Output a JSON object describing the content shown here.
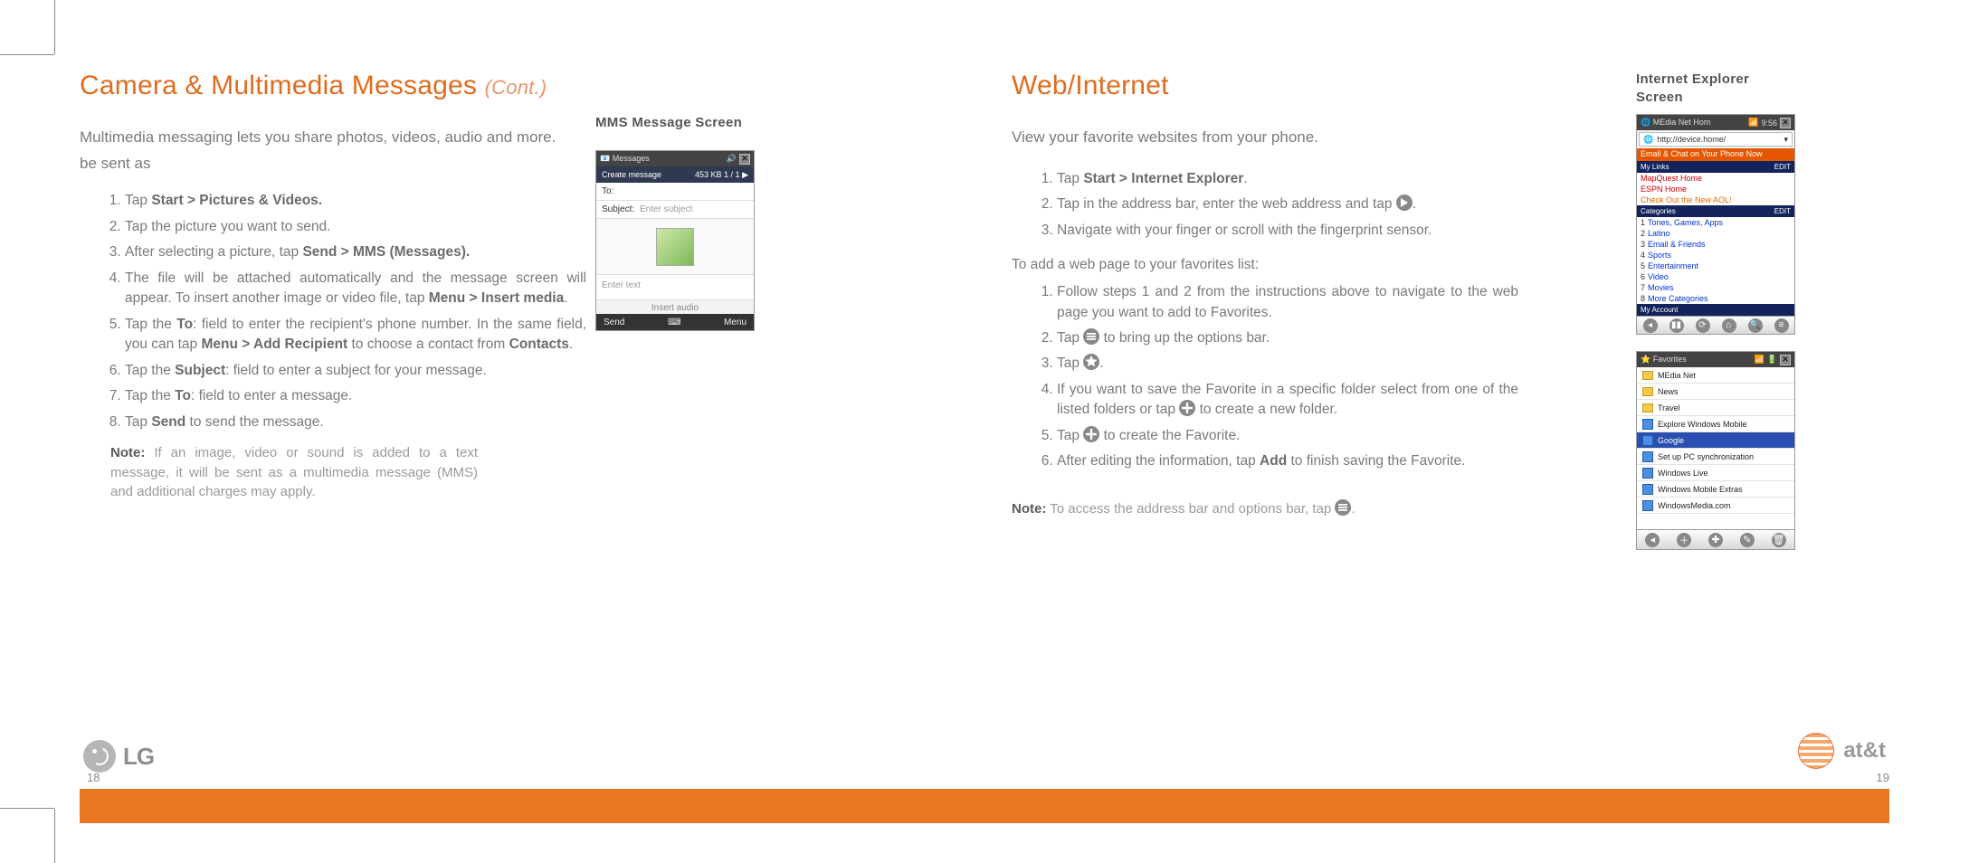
{
  "left": {
    "heading": "Camera & Multimedia Messages",
    "heading_cont": "(Cont.)",
    "intro1": "Multimedia messaging lets you share photos, videos, audio and more.",
    "intro2": "be sent as",
    "steps": {
      "s1a": "Tap ",
      "s1b": "Start > Pictures & Videos.",
      "s2": "Tap the picture you want to send.",
      "s3a": "After selecting a picture, tap ",
      "s3b": "Send > MMS (Messages).",
      "s4a": "The file will be attached automatically and the message screen will appear. To insert another image or video file, tap ",
      "s4b": "Menu > Insert media",
      "s4c": ".",
      "s5a": "Tap the ",
      "s5b": "To",
      "s5c": ": field to enter the recipient's phone number. In the same field, you can tap ",
      "s5d": "Menu > Add Recipient",
      "s5e": " to choose a contact from ",
      "s5f": "Contacts",
      "s5g": ".",
      "s6a": "Tap the ",
      "s6b": "Subject",
      "s6c": ": field to enter a subject for your message.",
      "s7a": "Tap the ",
      "s7b": "To",
      "s7c": ": field to enter a message.",
      "s8a": "Tap ",
      "s8b": "Send",
      "s8c": " to send the message."
    },
    "note_label": "Note:",
    "note_text": " If an image, video or sound is added to a text message, it will be sent as a multimedia message (MMS) and additional charges may apply.",
    "sidebar_label": "MMS Message Screen",
    "mms_screen": {
      "top_left": "Messages",
      "title_left": "Create message",
      "title_right": "453 KB    1 / 1  ▶",
      "to_label": "To:",
      "subject_label": "Subject:",
      "subject_placeholder": "Enter subject",
      "body_placeholder": "Enter text",
      "audio_placeholder": "Insert audio",
      "bottom_left": "Send",
      "bottom_right": "Menu"
    },
    "page_number": "18"
  },
  "right": {
    "heading": "Web/Internet",
    "intro": "View your favorite websites from your phone.",
    "steps1": {
      "s1a": "Tap ",
      "s1b": "Start > Internet Explorer",
      "s1c": ".",
      "s2a": "Tap in the address bar, enter the web address and tap ",
      "s2b": ".",
      "s3": "Navigate with your finger or scroll with the fingerprint sensor."
    },
    "sub": "To add a web page to your favorites list:",
    "steps2": {
      "s1": "Follow steps 1 and 2 from the instructions above to navigate to the web page you want to add to Favorites.",
      "s2a": "Tap ",
      "s2b": " to bring up the options bar.",
      "s3a": "Tap ",
      "s3b": ".",
      "s4a": "If you want to save the Favorite in a specific folder select from one of the listed folders or tap ",
      "s4b": " to create a new folder.",
      "s5a": "Tap ",
      "s5b": " to create the Favorite.",
      "s6a": "After editing the information, tap ",
      "s6b": "Add",
      "s6c": " to finish saving the Favorite."
    },
    "note_label": "Note:",
    "note_text": " To access the address bar and options bar, tap ",
    "note_end": ".",
    "sidebar_label": "Internet Explorer Screen",
    "ie_screen": {
      "top_left": "MEdia Net Hom",
      "top_time": "9:56",
      "addr": "http://device.home/",
      "banner": "Email & Chat on Your Phone Now",
      "mylinks_head": "My Links",
      "edit": "EDIT",
      "links": [
        "MapQuest Home",
        "ESPN Home",
        "Check Out the New AOL!"
      ],
      "cat_head": "Categories",
      "cats": [
        "Tones, Games, Apps",
        "Latino",
        "Email & Friends",
        "Sports",
        "Entertainment",
        "Video",
        "Movies",
        "More Categories"
      ],
      "account": "My Account"
    },
    "fav_screen": {
      "top_left": "Favorites",
      "items": [
        {
          "type": "folder",
          "label": "MEdia Net"
        },
        {
          "type": "folder",
          "label": "News"
        },
        {
          "type": "folder",
          "label": "Travel"
        },
        {
          "type": "link",
          "label": "Explore Windows Mobile"
        },
        {
          "type": "link",
          "label": "Google",
          "selected": true
        },
        {
          "type": "link",
          "label": "Set up PC synchronization"
        },
        {
          "type": "link",
          "label": "Windows Live"
        },
        {
          "type": "link",
          "label": "Windows Mobile Extras"
        },
        {
          "type": "link",
          "label": "WindowsMedia.com"
        }
      ]
    },
    "page_number": "19"
  },
  "brand": {
    "lg": "LG",
    "att": "at&t"
  }
}
